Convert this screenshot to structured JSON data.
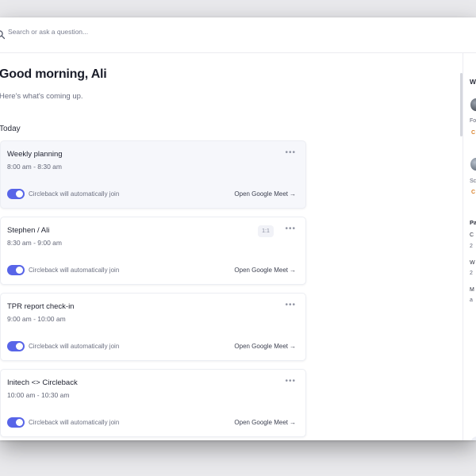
{
  "search": {
    "placeholder": "Search or ask a question..."
  },
  "greeting": "Good morning, Ali",
  "subtitle": "Here's what's coming up.",
  "section_today": "Today",
  "colors": {
    "accent": "#5865e8",
    "warning": "#d9822b"
  },
  "meetings": [
    {
      "title": "Weekly planning",
      "time": "8:00 am - 8:30 am",
      "toggle_label": "Circleback will automatically join",
      "link_label": "Open Google Meet",
      "toggle_on": true
    },
    {
      "title": "Stephen / Ali",
      "time": "8:30 am - 9:00 am",
      "badge": "1:1",
      "toggle_label": "Circleback will automatically join",
      "link_label": "Open Google Meet",
      "toggle_on": true
    },
    {
      "title": "TPR report check-in",
      "time": "9:00 am - 10:00 am",
      "toggle_label": "Circleback will automatically join",
      "link_label": "Open Google Meet",
      "toggle_on": true
    },
    {
      "title": "Initech <> Circleback",
      "time": "10:00 am - 10:30 am",
      "toggle_label": "Circleback will automatically join",
      "link_label": "Open Google Meet",
      "toggle_on": true
    }
  ],
  "right_panel": {
    "heading": "W",
    "item1_text": "Fo",
    "item1_tag": "C",
    "item2_text": "Sc",
    "item2_tag": "C",
    "section2": "Pa",
    "row1_title": "C",
    "row1_sub": "2",
    "row2_title": "W",
    "row2_sub": "2",
    "row3_title": "M",
    "row3_sub": "a"
  }
}
